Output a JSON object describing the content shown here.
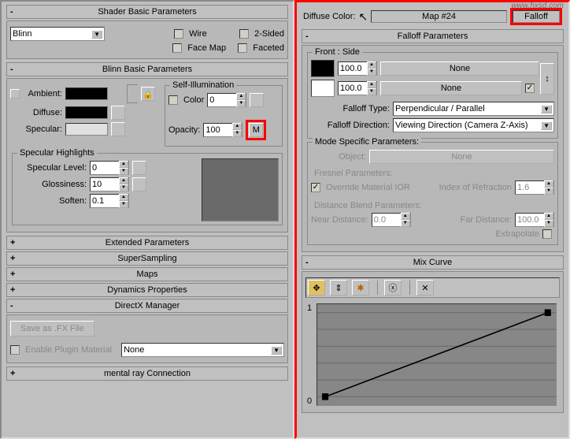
{
  "left": {
    "shader_header": "Shader Basic Parameters",
    "shader_type": "Blinn",
    "wire": "Wire",
    "two_sided": "2-Sided",
    "face_map": "Face Map",
    "faceted": "Faceted",
    "blinn_header": "Blinn Basic Parameters",
    "self_illum": "Self-Illumination",
    "color_label": "Color",
    "color_value": "0",
    "ambient": "Ambient:",
    "diffuse": "Diffuse:",
    "specular": "Specular:",
    "opacity": "Opacity:",
    "opacity_value": "100",
    "opacity_btn": "M",
    "spec_highlights": "Specular Highlights",
    "spec_level": "Specular Level:",
    "spec_level_val": "0",
    "glossiness": "Glossiness:",
    "glossiness_val": "10",
    "soften": "Soften:",
    "soften_val": "0.1",
    "extended": "Extended Parameters",
    "supersampling": "SuperSampling",
    "maps": "Maps",
    "dynamics": "Dynamics Properties",
    "directx": "DirectX Manager",
    "save_fx": "Save as .FX File",
    "enable_plugin": "Enable Plugin Material",
    "plugin_value": "None",
    "mental_ray": "mental ray Connection"
  },
  "right": {
    "diffuse_color": "Diffuse Color:",
    "map_name": "Map #24",
    "map_type": "Falloff",
    "falloff_header": "Falloff Parameters",
    "front_side": "Front : Side",
    "val1": "100.0",
    "none1": "None",
    "val2": "100.0",
    "none2": "None",
    "falloff_type": "Falloff Type:",
    "falloff_type_val": "Perpendicular / Parallel",
    "falloff_dir": "Falloff Direction:",
    "falloff_dir_val": "Viewing Direction (Camera Z-Axis)",
    "mode_specific": "Mode Specific Parameters:",
    "object": "Object:",
    "object_val": "None",
    "fresnel": "Fresnel Parameters:",
    "override_ior": "Override Material IOR",
    "ior_label": "Index of Refraction",
    "ior_val": "1.6",
    "distance_blend": "Distance Blend Parameters:",
    "near_dist": "Near Distance:",
    "near_val": "0.0",
    "far_dist": "Far Distance:",
    "far_val": "100.0",
    "extrapolate": "Extrapolate",
    "mix_curve": "Mix Curve",
    "axis_y1": "1",
    "axis_y0": "0",
    "watermark": "www.hxsd.com"
  }
}
